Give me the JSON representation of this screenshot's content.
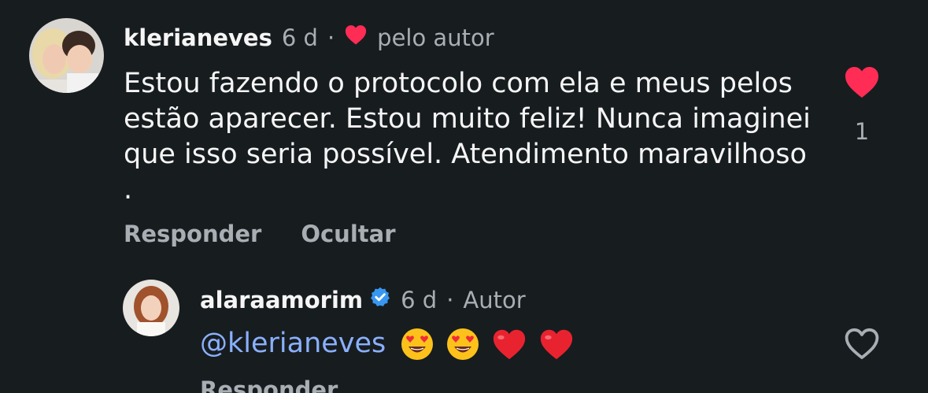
{
  "comment": {
    "username": "klerianeves",
    "time": "6 d",
    "separator": "·",
    "liked_by_author": "pelo autor",
    "text": "Estou fazendo o protocolo com ela e meus pelos estão aparecer. Estou muito feliz! Nunca imaginei que isso seria possível.  Atendimento maravilhoso .",
    "like_count": "1",
    "actions": {
      "reply": "Responder",
      "hide": "Ocultar"
    },
    "colors": {
      "heart": "#ff2d55"
    }
  },
  "reply": {
    "username": "alaraamorim",
    "verified": true,
    "time": "6 d",
    "separator": "·",
    "author_label": "Autor",
    "mention": "@klerianeves",
    "emojis": [
      "heart-eyes",
      "heart-eyes",
      "red-heart",
      "red-heart"
    ],
    "actions": {
      "reply": "Responder"
    },
    "colors": {
      "mention": "#8ab0ff",
      "verified": "#3897f0"
    }
  }
}
